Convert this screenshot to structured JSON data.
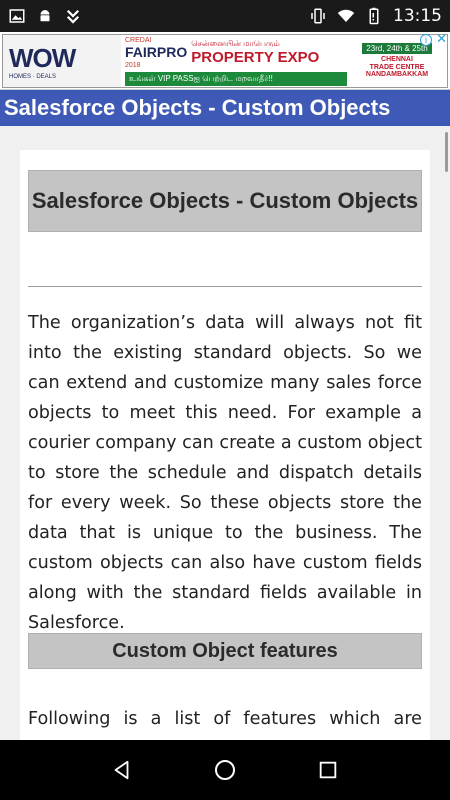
{
  "status_bar": {
    "time": "13:15",
    "left_icons": [
      "image-icon",
      "android-icon",
      "download-check-icon"
    ],
    "right_icons": [
      "vibrate-icon",
      "wifi-icon",
      "battery-icon"
    ]
  },
  "ad": {
    "logo_text": "WOW",
    "logo_sub": "HOMES · DEALS",
    "credai": "CREDAI",
    "fairpro": "FAIRPRO",
    "year": "2018",
    "tamil_line": "சென்னையின் மாபெரும்",
    "expo": "PROPERTY EXPO",
    "vip": "உங்கள் VIP PASSஐ பெற்றிட மறவாதீர்!!",
    "dates": "23rd, 24th & 25th",
    "venue_line1": "CHENNAI",
    "venue_line2": "TRADE CENTRE",
    "venue_line3": "NANDAMBAKKAM",
    "info_label": "i",
    "close_label": "✕"
  },
  "title_bar": {
    "title": "Salesforce Objects - Custom Objects"
  },
  "article": {
    "heading": "Salesforce Objects - Custom Objects",
    "paragraph_1": "The organization’s data will always not fit into the existing standard objects. So we can extend and customize many sales force objects to meet this need. For example a courier company can create a custom object to store the schedule and dispatch details for every week. So these objects store the data that is unique to the business. The custom objects can also have custom fields along with the standard fields available in Salesforce.",
    "section_heading": "Custom Object features",
    "paragraph_2": "Following is a list of features which are"
  },
  "nav_bar": {
    "buttons": [
      "back-icon",
      "home-icon",
      "recents-icon"
    ]
  },
  "colors": {
    "title_bar_bg": "#3f5ab6",
    "heading_bg": "#c4c4c4",
    "status_bar_bg": "#1a1a1a",
    "nav_bar_bg": "#000000"
  }
}
